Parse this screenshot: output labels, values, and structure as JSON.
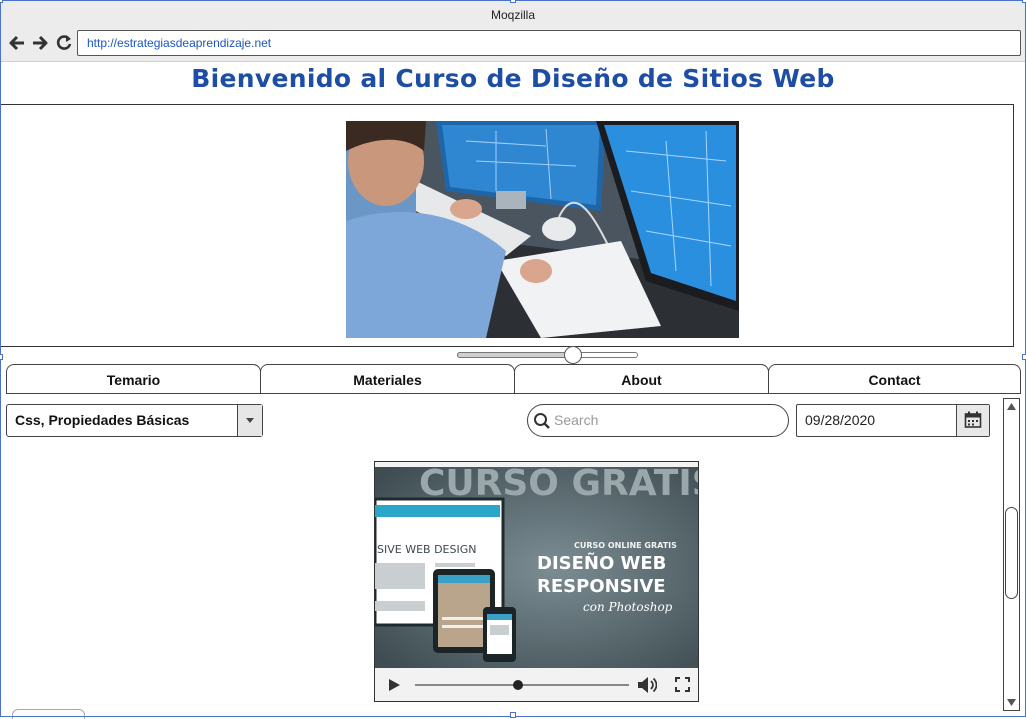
{
  "window": {
    "title": "Moqzilla"
  },
  "browser": {
    "url": "http://estrategiasdeaprendizaje.net"
  },
  "page": {
    "title": "Bienvenido al Curso de Diseño de Sitios Web"
  },
  "slider": {
    "value": 0.64
  },
  "tabs": [
    {
      "label": "Temario"
    },
    {
      "label": "Materiales"
    },
    {
      "label": "About"
    },
    {
      "label": "Contact"
    }
  ],
  "controls": {
    "dropdown_value": "Css, Propiedades Básicas",
    "search_placeholder": "Search",
    "date_value": "09/28/2020"
  },
  "video": {
    "overlay_top": "CURSO GRATIS",
    "overlay_side": "SIVE WEB DESIGN",
    "overlay_small": "CURSO ONLINE GRATIS",
    "overlay_line1": "DISEÑO WEB",
    "overlay_line2": "RESPONSIVE",
    "overlay_line3": "con Photoshop",
    "progress": 0.48
  }
}
